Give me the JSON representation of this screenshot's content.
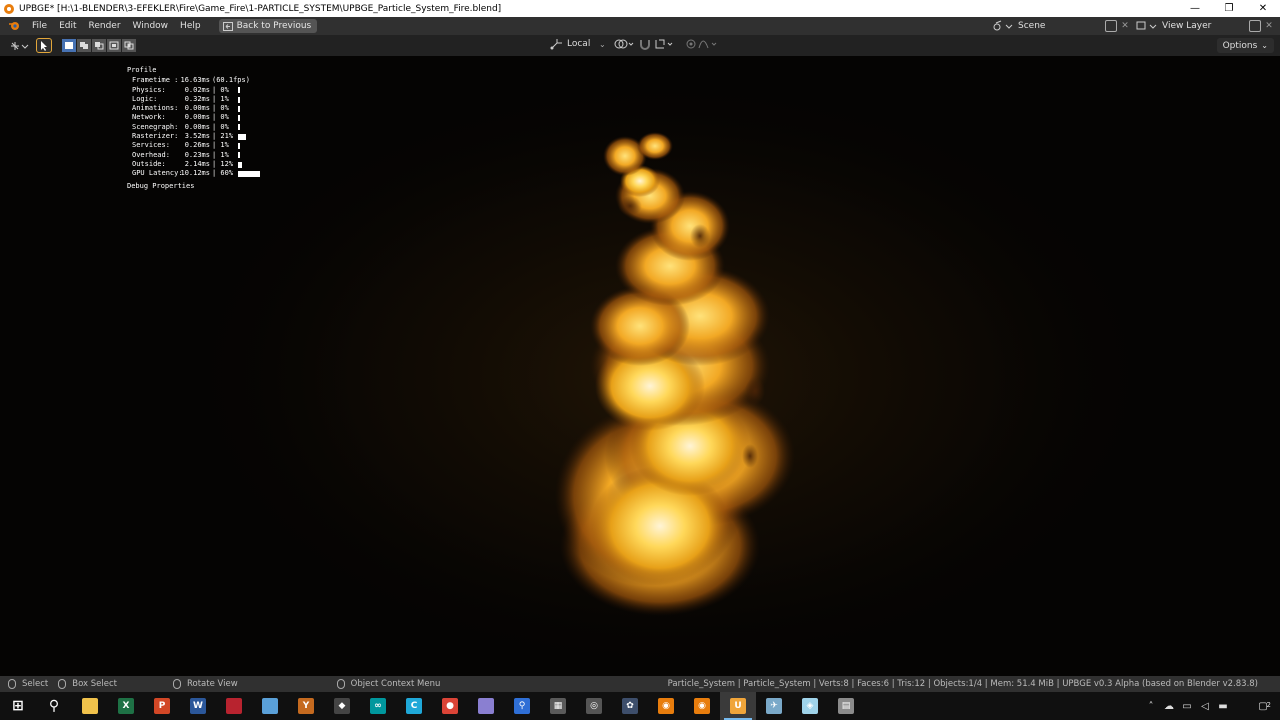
{
  "window": {
    "title": "UPBGE* [H:\\1-BLENDER\\3-EFEKLER\\Fire\\Game_Fire\\1-PARTICLE_SYSTEM\\UPBGE_Particle_System_Fire.blend]",
    "minimize_glyph": "—",
    "restore_glyph": "❐",
    "close_glyph": "✕"
  },
  "menubar": {
    "items": [
      "File",
      "Edit",
      "Render",
      "Window",
      "Help"
    ],
    "back_button": "Back to Previous",
    "scene_label": "Scene",
    "view_layer_label": "View Layer"
  },
  "toolbar": {
    "transform_orientation": "Local",
    "options_label": "Options"
  },
  "profile": {
    "title": "Profile",
    "rows": [
      {
        "name": "Frametime :",
        "value": "16.63ms",
        "pct": "(60.1fps)",
        "fraction": 0
      },
      {
        "name": "Physics:",
        "value": "0.02ms",
        "pct": "| 0%",
        "fraction": 0.0
      },
      {
        "name": "Logic:",
        "value": "0.32ms",
        "pct": "| 1%",
        "fraction": 0.01
      },
      {
        "name": "Animations:",
        "value": "0.00ms",
        "pct": "| 0%",
        "fraction": 0.0
      },
      {
        "name": "Network:",
        "value": "0.00ms",
        "pct": "| 0%",
        "fraction": 0.0
      },
      {
        "name": "Scenegraph:",
        "value": "0.00ms",
        "pct": "| 0%",
        "fraction": 0.0
      },
      {
        "name": "Rasterizer:",
        "value": "3.52ms",
        "pct": "| 21%",
        "fraction": 0.21
      },
      {
        "name": "Services:",
        "value": "0.26ms",
        "pct": "| 1%",
        "fraction": 0.01
      },
      {
        "name": "Overhead:",
        "value": "0.23ms",
        "pct": "| 1%",
        "fraction": 0.01
      },
      {
        "name": "Outside:",
        "value": "2.14ms",
        "pct": "| 12%",
        "fraction": 0.12
      },
      {
        "name": "GPU Latency:",
        "value": "10.12ms",
        "pct": "| 60%",
        "fraction": 0.6
      }
    ],
    "debug_label": "Debug Properties"
  },
  "statusbar": {
    "select": "Select",
    "box_select": "Box Select",
    "rotate_view": "Rotate View",
    "context_menu": "Object Context Menu",
    "stats": "Particle_System | Particle_System | Verts:8 | Faces:6 | Tris:12 | Objects:1/4 | Mem: 51.4 MiB  |  UPBGE v0.3 Alpha (based on Blender v2.83.8)"
  },
  "taskbar": {
    "apps": [
      {
        "name": "start-button",
        "color": "#ffffff",
        "glyph": "⊞"
      },
      {
        "name": "search-button",
        "color": "#ffffff",
        "glyph": "⚲"
      },
      {
        "name": "file-explorer",
        "color": "#f0c24b",
        "glyph": ""
      },
      {
        "name": "excel",
        "color": "#1e7145",
        "glyph": "X"
      },
      {
        "name": "powerpoint",
        "color": "#d24726",
        "glyph": "P"
      },
      {
        "name": "word",
        "color": "#2b579a",
        "glyph": "W"
      },
      {
        "name": "pdf-reader",
        "color": "#b8232f",
        "glyph": ""
      },
      {
        "name": "remote-desktop",
        "color": "#5aa0d8",
        "glyph": ""
      },
      {
        "name": "orange-app",
        "color": "#c56a1f",
        "glyph": "Y"
      },
      {
        "name": "inkscape",
        "color": "#444444",
        "glyph": "◆"
      },
      {
        "name": "arduino",
        "color": "#00979d",
        "glyph": "∞"
      },
      {
        "name": "c-app",
        "color": "#1fa8d8",
        "glyph": "C"
      },
      {
        "name": "chrome",
        "color": "#db4437",
        "glyph": "●"
      },
      {
        "name": "document-app",
        "color": "#8a7fd1",
        "glyph": ""
      },
      {
        "name": "search-tool",
        "color": "#2f6fd6",
        "glyph": "⚲"
      },
      {
        "name": "calculator",
        "color": "#5a5a5a",
        "glyph": "▦"
      },
      {
        "name": "bge-app",
        "color": "#555555",
        "glyph": "◎"
      },
      {
        "name": "davinci-resolve",
        "color": "#3d4e6b",
        "glyph": "✿"
      },
      {
        "name": "blender",
        "color": "#e87d0d",
        "glyph": "◉"
      },
      {
        "name": "blender-2",
        "color": "#e87d0d",
        "glyph": "◉"
      },
      {
        "name": "upbge",
        "color": "#f0a53a",
        "glyph": "U",
        "active": true
      },
      {
        "name": "tool-app",
        "color": "#7aa9c9",
        "glyph": "✈"
      },
      {
        "name": "cube-app",
        "color": "#9fd3ea",
        "glyph": "◈"
      },
      {
        "name": "chip-app",
        "color": "#8b8b8b",
        "glyph": "▤"
      }
    ],
    "notification_count": "2"
  },
  "colors": {
    "accent": "#4772b3",
    "select_outline": "#e2a63a",
    "panel": "#303030",
    "header": "#222222"
  }
}
